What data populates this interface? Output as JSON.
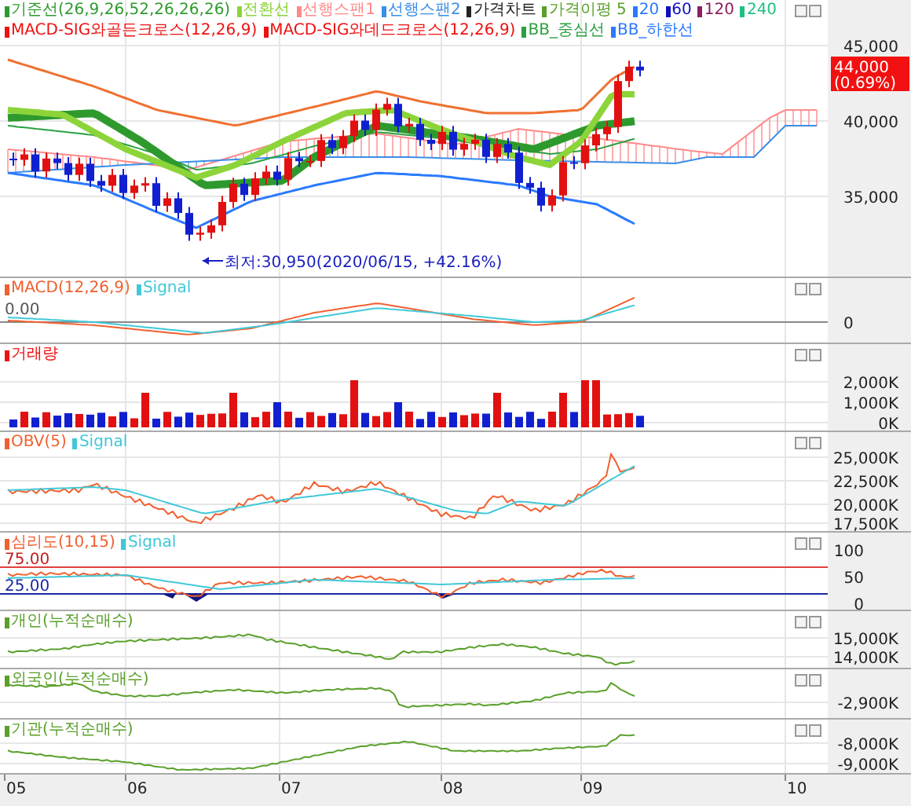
{
  "price_panel": {
    "legend_rows": [
      [
        {
          "label": "기준선(26,9,26,52,26,26,26)",
          "color": "#2e9a2e"
        },
        {
          "label": "전환선",
          "color": "#8cd43a"
        },
        {
          "label": "선행스팬1",
          "color": "#ff8a8a"
        },
        {
          "label": "선행스팬2",
          "color": "#3a8ee8"
        },
        {
          "label": "가격차트",
          "color": "#222222"
        },
        {
          "label": "가격이평 5",
          "color": "#5aa02a"
        },
        {
          "label": "20",
          "color": "#2a7aff"
        },
        {
          "label": "60",
          "color": "#1010c0"
        },
        {
          "label": "120",
          "color": "#8a2060"
        },
        {
          "label": "240",
          "color": "#20c080"
        }
      ],
      [
        {
          "label": "MACD-SIG와골든크로스(12,26,9)",
          "color": "#ee1111"
        },
        {
          "label": "MACD-SIG와데드크로스(12,26,9)",
          "color": "#ee1111"
        },
        {
          "label": "BB_중심선",
          "color": "#2aa040"
        },
        {
          "label": "BB_하한선",
          "color": "#2a7aff"
        }
      ]
    ],
    "y_ticks": [
      "45,000",
      "40,000",
      "35,000"
    ],
    "current_price": "44,000",
    "current_change": "(0.69%)",
    "low_marker": "최저:30,950(2020/06/15, +42.16%)"
  },
  "macd_panel": {
    "legend": [
      {
        "label": "MACD(12,26,9)",
        "color": "#f06030"
      },
      {
        "label": "Signal",
        "color": "#40c8d8"
      }
    ],
    "level_label": "0.00",
    "y_ticks": [
      "0"
    ]
  },
  "volume_panel": {
    "legend": [
      {
        "label": "거래량",
        "color": "#ee1111"
      }
    ],
    "y_ticks": [
      "2,000K",
      "1,000K",
      "0K"
    ]
  },
  "obv_panel": {
    "legend": [
      {
        "label": "OBV(5)",
        "color": "#f06030"
      },
      {
        "label": "Signal",
        "color": "#40c8d8"
      }
    ],
    "y_ticks": [
      "25,000K",
      "22,500K",
      "20,000K",
      "17,500K"
    ]
  },
  "psych_panel": {
    "legend": [
      {
        "label": "심리도(10,15)",
        "color": "#f06030"
      },
      {
        "label": "Signal",
        "color": "#40c8d8"
      }
    ],
    "upper_label": "75.00",
    "lower_label": "25.00",
    "y_ticks": [
      "100",
      "50",
      "0"
    ]
  },
  "individual_panel": {
    "legend": [
      {
        "label": "개인(누적순매수)",
        "color": "#5aa02a"
      }
    ],
    "y_ticks": [
      "15,000K",
      "14,000K"
    ]
  },
  "foreign_panel": {
    "legend": [
      {
        "label": "외국인(누적순매수)",
        "color": "#5aa02a"
      }
    ],
    "y_ticks": [
      "-2,900K"
    ]
  },
  "institution_panel": {
    "legend": [
      {
        "label": "기관(누적순매수)",
        "color": "#5aa02a"
      }
    ],
    "y_ticks": [
      "-8,000K",
      "-9,000K"
    ]
  },
  "x_axis": [
    "05",
    "06",
    "07",
    "08",
    "09",
    "10"
  ]
}
